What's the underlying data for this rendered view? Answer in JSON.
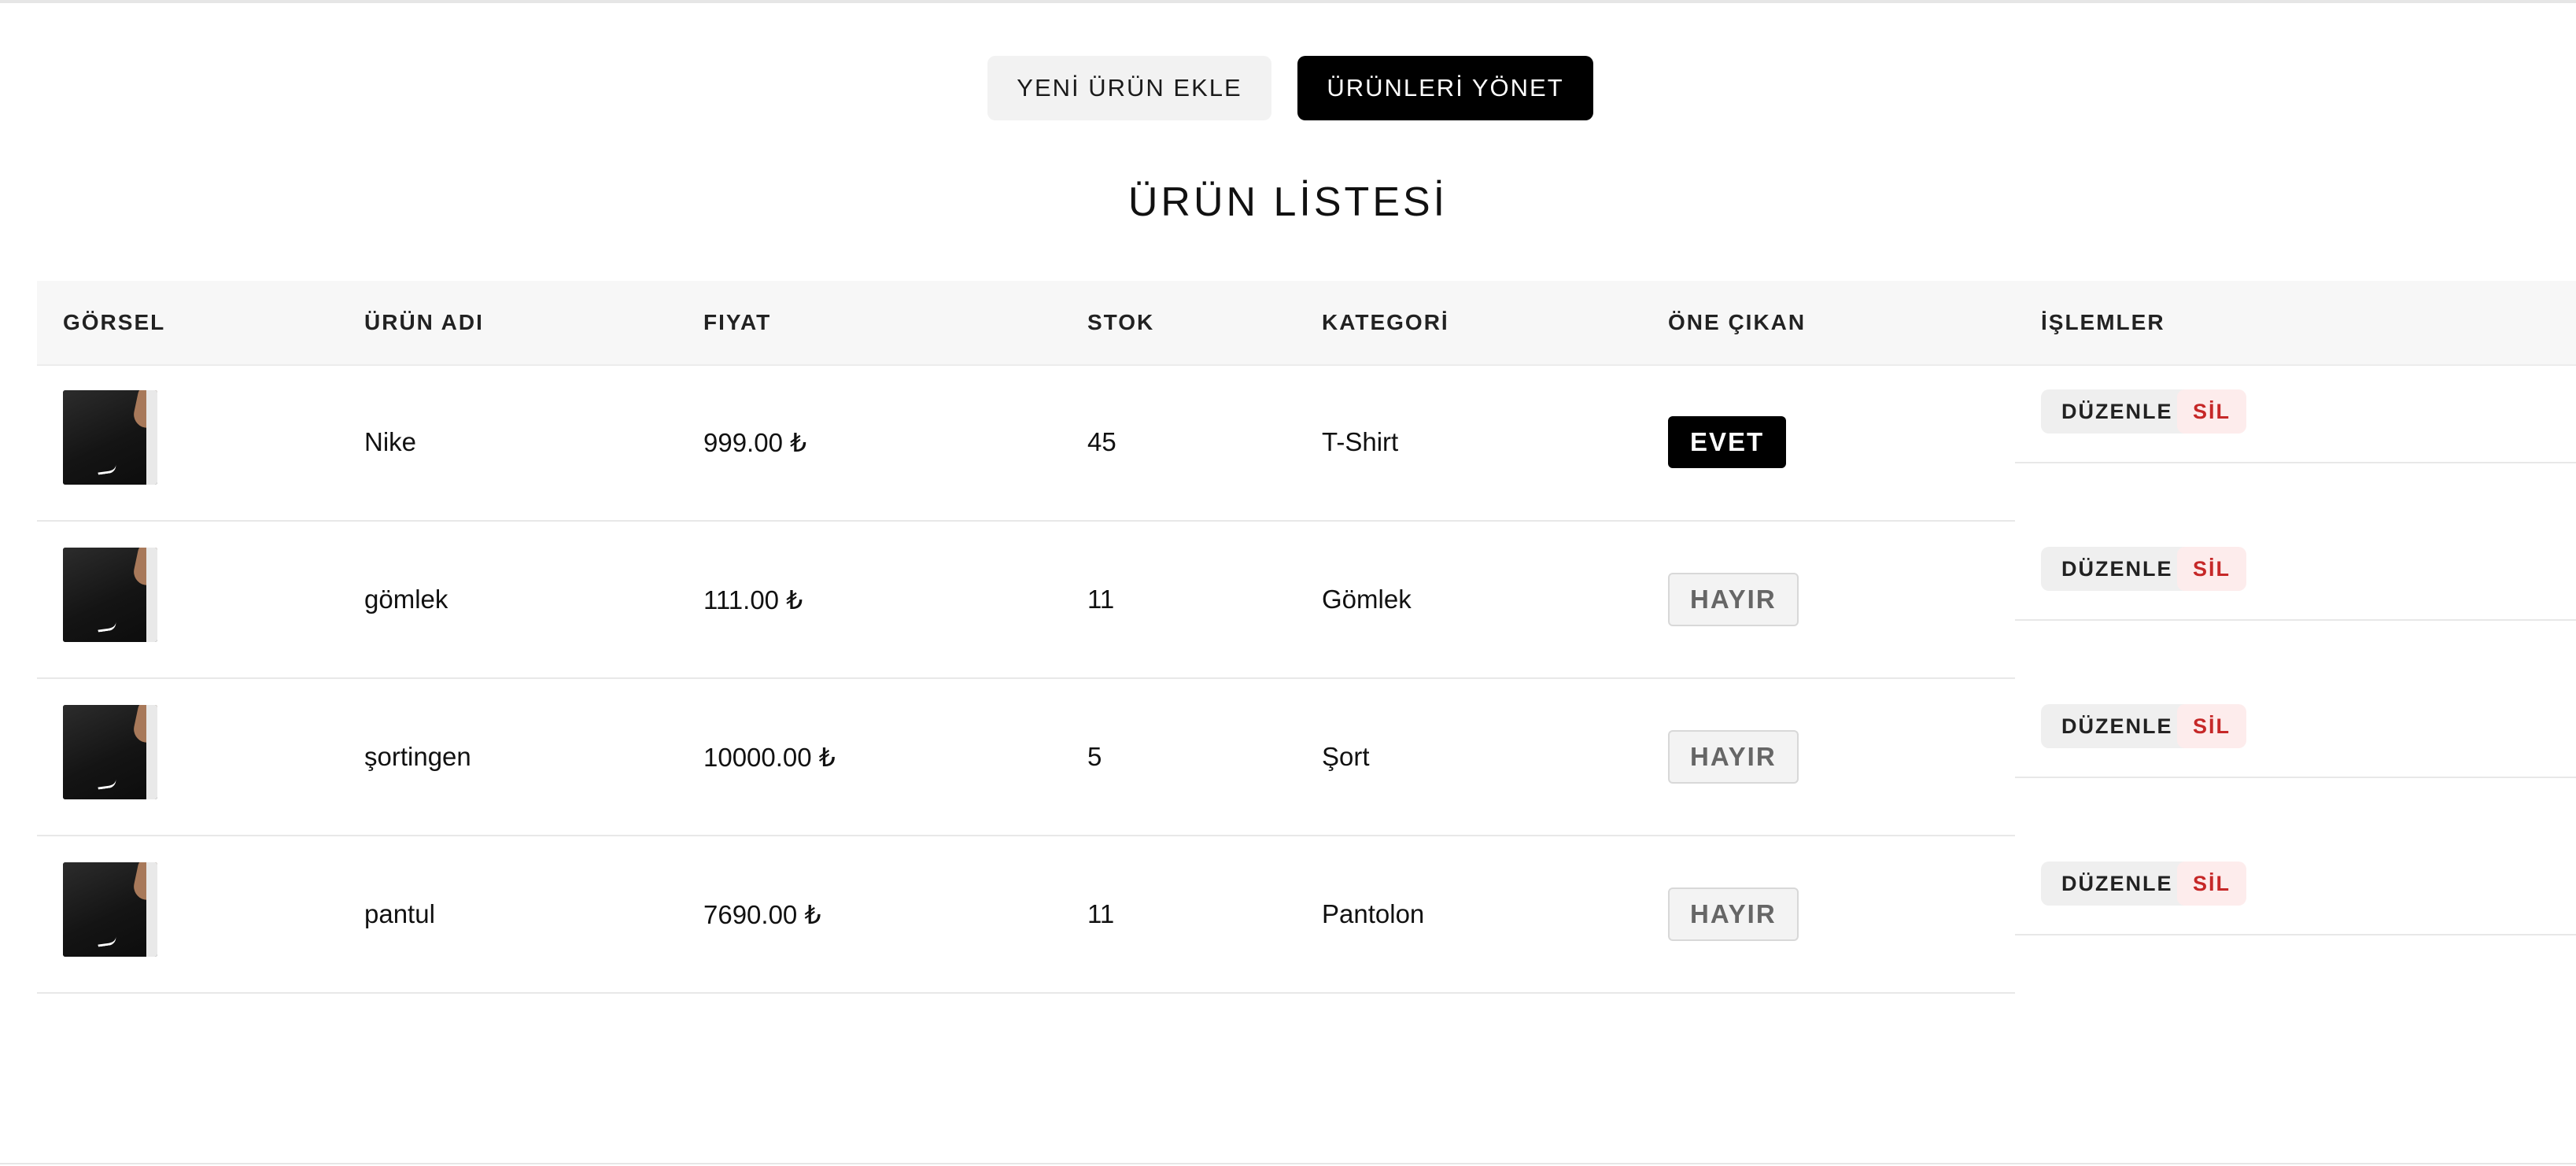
{
  "nav": {
    "add_product_label": "YENİ ÜRÜN EKLE",
    "manage_products_label": "ÜRÜNLERİ YÖNET"
  },
  "page_title": "ÜRÜN LİSTESİ",
  "table": {
    "headers": {
      "image": "GÖRSEL",
      "name": "ÜRÜN ADI",
      "price": "FIYAT",
      "stock": "STOK",
      "category": "KATEGORİ",
      "featured": "ÖNE ÇIKAN",
      "actions": "İŞLEMLER"
    },
    "rows": [
      {
        "name": "Nike",
        "price": "999.00 ₺",
        "stock": "45",
        "category": "T-Shirt",
        "featured": "EVET",
        "edit_label": "DÜZENLE",
        "delete_label": "SİL"
      },
      {
        "name": "gömlek",
        "price": "111.00 ₺",
        "stock": "11",
        "category": "Gömlek",
        "featured": "HAYIR",
        "edit_label": "DÜZENLE",
        "delete_label": "SİL"
      },
      {
        "name": "şortingen",
        "price": "10000.00 ₺",
        "stock": "5",
        "category": "Şort",
        "featured": "HAYIR",
        "edit_label": "DÜZENLE",
        "delete_label": "SİL"
      },
      {
        "name": "pantul",
        "price": "7690.00 ₺",
        "stock": "11",
        "category": "Pantolon",
        "featured": "HAYIR",
        "edit_label": "DÜZENLE",
        "delete_label": "SİL"
      }
    ]
  },
  "colors": {
    "accent": "#000000",
    "danger_text": "#c62828",
    "danger_bg": "#fdecec",
    "header_bg": "#f7f7f7"
  },
  "icons": {
    "product_image": "product-thumbnail-image"
  }
}
